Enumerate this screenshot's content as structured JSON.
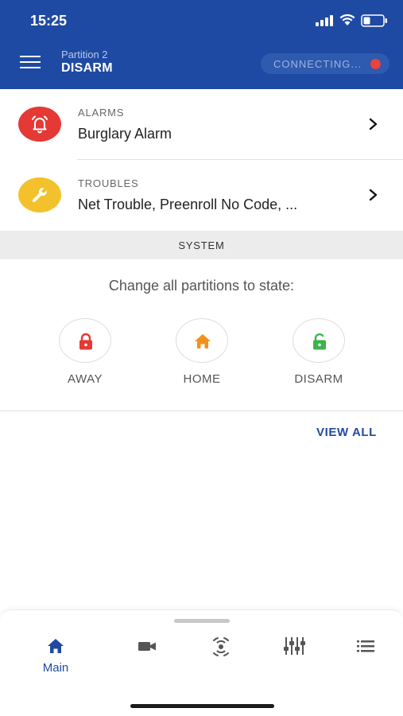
{
  "status_bar": {
    "time": "15:25",
    "icons": [
      "cellular-signal-icon",
      "wifi-icon",
      "battery-icon"
    ]
  },
  "header": {
    "partition_label": "Partition 2",
    "partition_state": "DISARM",
    "connection_status": "CONNECTING...",
    "colors": {
      "background": "#1f4aa3",
      "status_dot": "#e8433c"
    }
  },
  "alarms": {
    "label": "ALARMS",
    "value": "Burglary Alarm",
    "icon": "alarm-bell-icon",
    "color": "#e53935"
  },
  "troubles": {
    "label": "TROUBLES",
    "value": "Net Trouble, Preenroll No Code, ...",
    "icon": "wrench-icon",
    "color": "#f3c12b"
  },
  "system": {
    "title": "SYSTEM",
    "change_label": "Change all partitions to state:",
    "states": [
      {
        "label": "AWAY",
        "icon": "lock-closed-icon",
        "color": "#e53935"
      },
      {
        "label": "HOME",
        "icon": "home-icon",
        "color": "#f0921f"
      },
      {
        "label": "DISARM",
        "icon": "lock-open-icon",
        "color": "#3cb44a"
      }
    ],
    "view_all": "VIEW ALL"
  },
  "bottom_nav": {
    "items": [
      {
        "label": "Main",
        "icon": "home-icon",
        "active": true
      },
      {
        "label": "",
        "icon": "camera-icon",
        "active": false
      },
      {
        "label": "",
        "icon": "sensor-icon",
        "active": false
      },
      {
        "label": "",
        "icon": "mixer-icon",
        "active": false
      },
      {
        "label": "",
        "icon": "list-icon",
        "active": false
      }
    ]
  }
}
